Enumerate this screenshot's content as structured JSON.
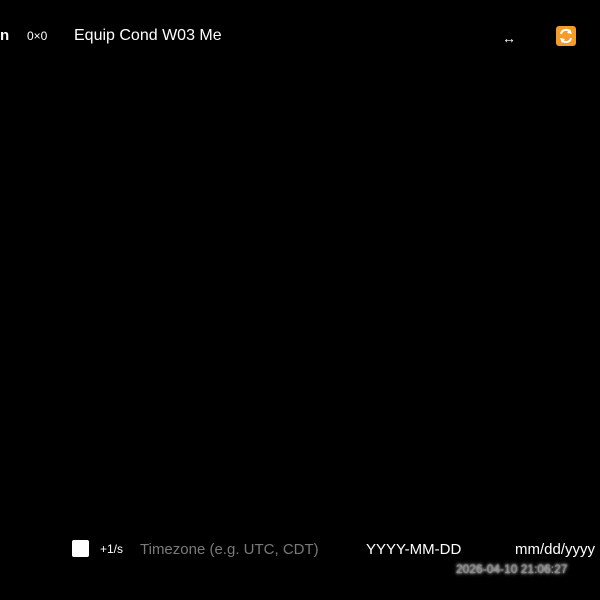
{
  "header": {
    "brand_fragment": "n",
    "dimensions": "0×0",
    "title": "Equip Cond W03 Me",
    "resize_glyph": "↔",
    "refresh_icon": "refresh-icon",
    "refresh_color": "#f39c2a"
  },
  "footer": {
    "checkbox_checked": false,
    "rate": "+1/s",
    "timezone_placeholder": "Timezone (e.g. UTC, CDT)",
    "timezone_value": "",
    "date_format": "YYYY-MM-DD",
    "date_field": "mm/dd/yyyy",
    "timestamp": "2026-04-10 21:06:27"
  },
  "colors": {
    "background": "#000000",
    "text": "#ffffff",
    "placeholder": "#7a7a7a"
  }
}
